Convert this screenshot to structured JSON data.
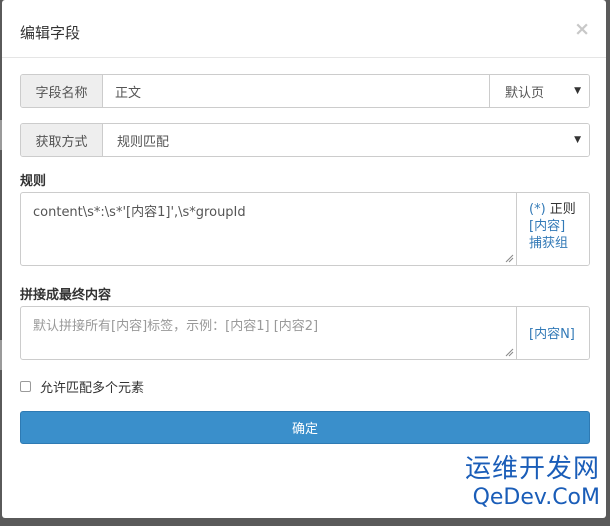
{
  "dialog": {
    "title": "编辑字段",
    "close_glyph": "×"
  },
  "field_name": {
    "addon_label": "字段名称",
    "value": "正文",
    "page_select": "默认页"
  },
  "fetch_method": {
    "addon_label": "获取方式",
    "selected": "规则匹配"
  },
  "rule": {
    "label": "规则",
    "value": "content\\s*:\\s*'[内容1]',\\s*groupId",
    "side_line1_link": "(*)",
    "side_line1_text": "正则",
    "side_line2": "[内容]",
    "side_line3": "捕获组"
  },
  "concat": {
    "label": "拼接成最终内容",
    "placeholder": "默认拼接所有[内容]标签，示例：[内容1] [内容2]",
    "side_link": "[内容N]"
  },
  "allow_multiple": {
    "label": "允许匹配多个元素",
    "checked": false
  },
  "confirm_button": "确定",
  "watermark": {
    "line1": "运维开发网",
    "line2": "QeDev.CoM"
  },
  "colors": {
    "primary": "#3a8fcb",
    "link": "#337ab7",
    "watermark": "#1a5db8"
  }
}
